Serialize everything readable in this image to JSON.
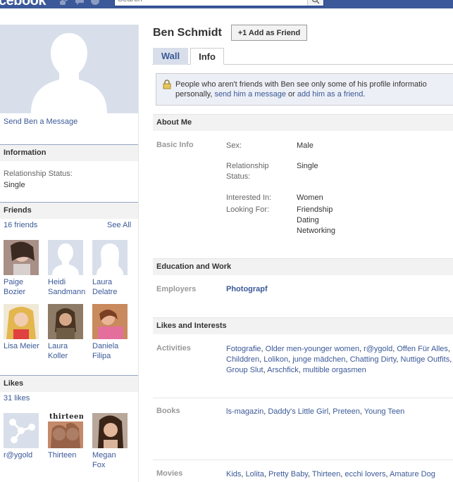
{
  "header": {
    "logo": "cebook",
    "search_placeholder": "Search"
  },
  "profile": {
    "name": "Ben Schmidt",
    "add_friend_label": "+1 Add as Friend",
    "send_message": "Send Ben a Message"
  },
  "tabs": [
    {
      "label": "Wall"
    },
    {
      "label": "Info"
    }
  ],
  "notice": {
    "line1": "People who aren't friends with Ben see only some of his profile informatio",
    "line2_pre": "personally, ",
    "link1": "send him a message",
    "mid": " or ",
    "link2": "add him as a friend",
    "end": "."
  },
  "sidebar": {
    "information": {
      "title": "Information",
      "rel_label": "Relationship Status:",
      "rel_value": "Single"
    },
    "friends": {
      "title": "Friends",
      "count": "16 friends",
      "see_all": "See All",
      "items": [
        {
          "name1": "Paige",
          "name2": "Bozier"
        },
        {
          "name1": "Heidi",
          "name2": "Sandmann"
        },
        {
          "name1": "Laura",
          "name2": "Delatre"
        },
        {
          "name1": "Lisa Meier",
          "name2": ""
        },
        {
          "name1": "Laura",
          "name2": "Koller"
        },
        {
          "name1": "Daniela",
          "name2": "Filipa"
        }
      ]
    },
    "likes": {
      "title": "Likes",
      "count": "31 likes",
      "thumb_caption": "thirteen",
      "items": [
        {
          "name1": "r@ygold",
          "name2": ""
        },
        {
          "name1": "Thirteen",
          "name2": ""
        },
        {
          "name1": "Megan",
          "name2": "Fox"
        }
      ]
    }
  },
  "about": {
    "title": "About Me",
    "basic_info_label": "Basic Info",
    "sex_label": "Sex:",
    "sex_value": "Male",
    "rel_label1": "Relationship",
    "rel_label2": "Status:",
    "rel_value": "Single",
    "interested_label": "Interested In:",
    "interested_value": "Women",
    "looking_label": "Looking For:",
    "looking_values": [
      "Friendship",
      "Dating",
      "Networking"
    ]
  },
  "education": {
    "title": "Education and Work",
    "employers_label": "Employers",
    "employers_value": "Photograpf"
  },
  "likes_interests": {
    "title": "Likes and Interests",
    "activities_label": "Activities",
    "activities": [
      "Fotografie",
      "Older men-younger women",
      "r@ygold",
      "Offen Für Alles",
      "Childdren",
      "Lolikon",
      "junge mädchen",
      "Chatting Dirty",
      "Nuttige Outfits",
      "Group Slut",
      "Arschfick",
      "multible orgasmen"
    ],
    "books_label": "Books",
    "books": [
      "ls-magazin",
      "Daddy's Little Girl",
      "Preteen",
      "Young Teen"
    ],
    "movies_label": "Movies",
    "movies": [
      "Kids",
      "Lolita",
      "Pretty Baby",
      "Thirteen",
      "ecchi lovers",
      "Amature Dog"
    ]
  }
}
